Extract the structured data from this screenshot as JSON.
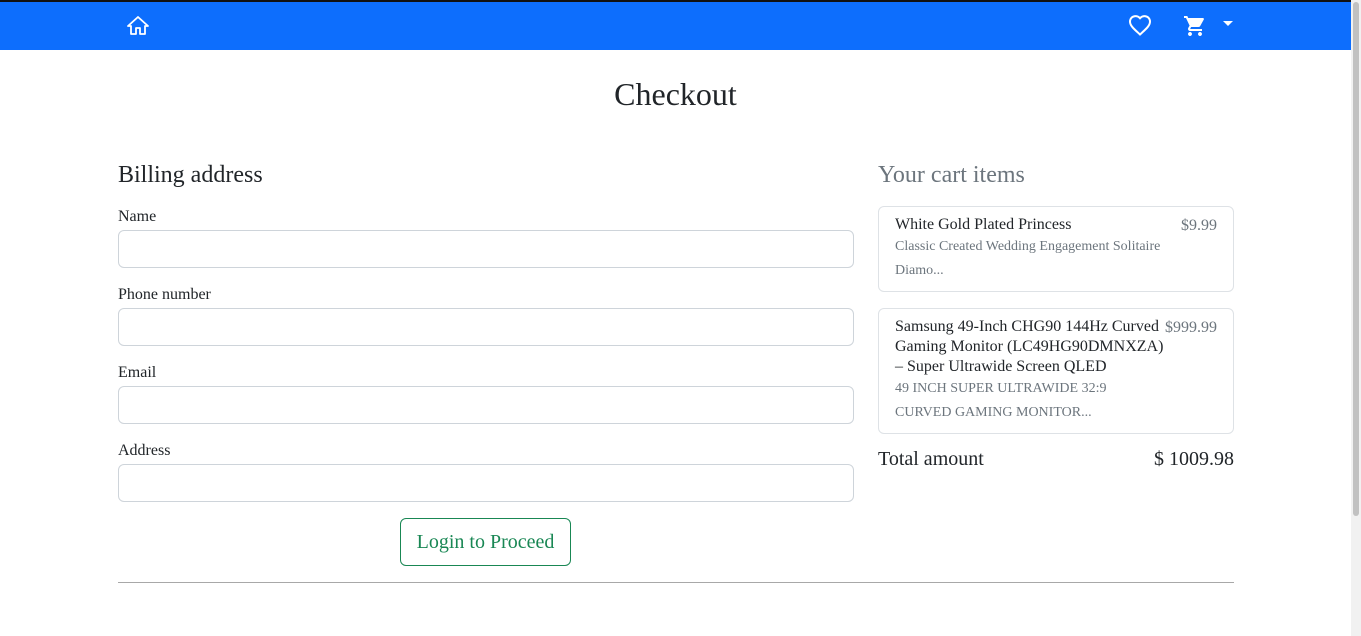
{
  "nav": {
    "icons": [
      "home-icon",
      "heart-icon",
      "cart-icon",
      "caret-down-icon"
    ],
    "brand_color": "#0d6efd"
  },
  "page": {
    "title": "Checkout"
  },
  "billing": {
    "heading": "Billing address",
    "fields": [
      {
        "label": "Name",
        "value": "",
        "placeholder": ""
      },
      {
        "label": "Phone number",
        "value": "",
        "placeholder": ""
      },
      {
        "label": "Email",
        "value": "",
        "placeholder": ""
      },
      {
        "label": "Address",
        "value": "",
        "placeholder": ""
      }
    ],
    "proceed_label": "Login to Proceed",
    "proceed_color": "#198754"
  },
  "cart": {
    "heading": "Your cart items",
    "items": [
      {
        "name": "White Gold Plated Princess",
        "description": "Classic Created Wedding Engagement Solitaire Diamo...",
        "price": "$9.99"
      },
      {
        "name": "Samsung 49-Inch CHG90 144Hz Curved Gaming Monitor (LC49HG90DMNXZA) – Super Ultrawide Screen QLED",
        "description": "49 INCH SUPER ULTRAWIDE 32:9 CURVED GAMING MONITOR...",
        "price": "$999.99"
      }
    ],
    "total_label": "Total amount",
    "total_value": "$ 1009.98"
  }
}
